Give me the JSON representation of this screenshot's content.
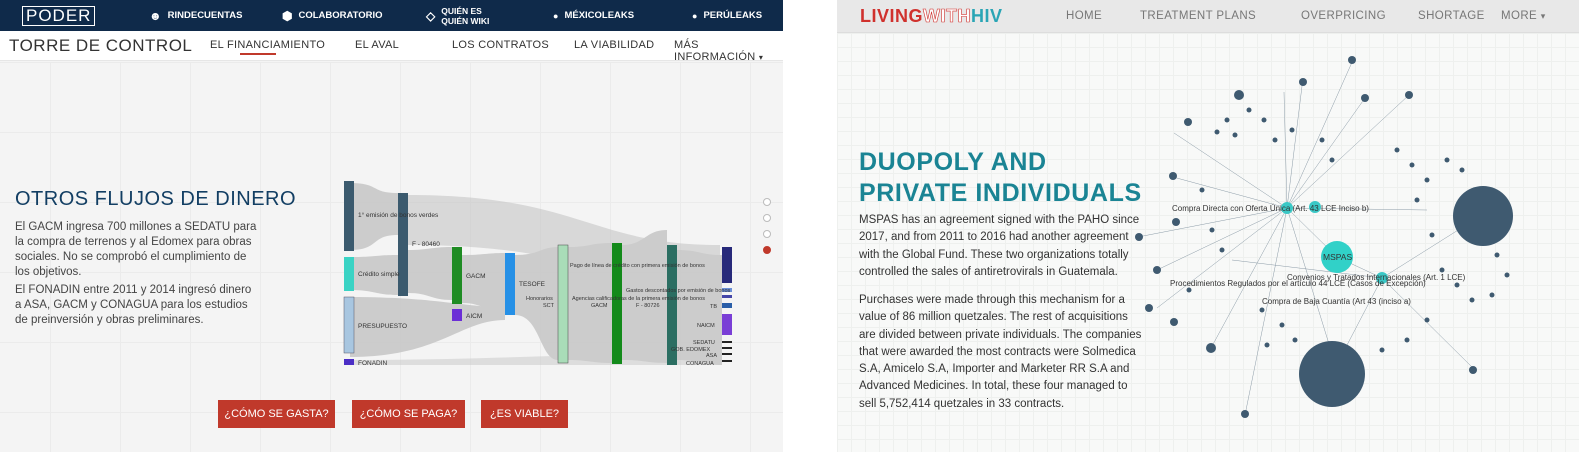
{
  "left": {
    "logo": "PODER",
    "top_nav": [
      {
        "icon": "☻",
        "icon_name": "rindecuentas-icon",
        "label": "RINDECUENTAS"
      },
      {
        "icon": "⬢",
        "icon_name": "cube-icon",
        "label": "COLABORATORIO"
      },
      {
        "icon": "◇",
        "icon_name": "wiki-icon",
        "label": "QUIÉN ES QUIÉN WIKI"
      },
      {
        "icon": "●",
        "icon_name": "drop-icon",
        "label": "MÉXICOLEAKS"
      },
      {
        "icon": "●",
        "icon_name": "drop-icon",
        "label": "PERÚLEAKS"
      }
    ],
    "site_title": "TORRE DE CONTROL",
    "sub_nav": [
      "EL FINANCIAMIENTO",
      "EL AVAL",
      "LOS CONTRATOS",
      "LA VIABILIDAD",
      "MÁS INFORMACIÓN"
    ],
    "heading": "OTROS FLUJOS DE DINERO",
    "para1": "El GACM ingresa 700 millones a SEDATU para la compra de terrenos y al Edomex para obras sociales. No se comprobó el cumplimiento de los objetivos.",
    "para2": "El FONADIN entre 2011 y 2014 ingresó dinero a ASA, GACM y CONAGUA para los estudios de preinversión y obras preliminares.",
    "buttons": [
      "¿CÓMO SE GASTA?",
      "¿CÓMO SE PAGA?",
      "¿ES VIABLE?"
    ],
    "accent": "#c0392b",
    "navy": "#0f2a4a",
    "sankey_labels": {
      "n1": "1° emisión de bonos verdes",
      "n2": "Crédito simple",
      "n3": "PRESUPUESTO",
      "n4": "FONADIN",
      "f": "F - 80460",
      "gacm": "GACM",
      "aicm": "AICM",
      "tesofe": "TESOFE",
      "pago": "Pago de línea de crédito con primera emisión de bonos",
      "gastos": "Gastos descontados por emisión de bonos",
      "hon": "Honorarios",
      "sct": "SCT",
      "agencias": "Agencias calificadoras de la primera emisión de bonos",
      "f2": "F - 80726",
      "gacm2": "GACM",
      "tb": "TB",
      "naicm": "NAICM",
      "sedatu": "SEDATU",
      "gob": "GOB. EDOMEX",
      "asa": "ASA",
      "conagua": "CONAGUA"
    }
  },
  "right": {
    "brand_a": "LIVING",
    "brand_b": "WITH",
    "brand_c": "HIV",
    "nav": [
      "HOME",
      "TREATMENT PLANS",
      "OVERPRICING",
      "SHORTAGE",
      "MORE"
    ],
    "title_line1": "DUOPOLY AND",
    "title_line2": "PRIVATE INDIVIDUALS",
    "para1": "MSPAS has an agreement signed with the PAHO since 2017, and from 2011 to 2016 had another agreement with the Global Fund. These two organizations totally controlled the sales of antiretrovirals in Guatemala.",
    "para2": "Purchases were made through this mechanism for a value of 86 million quetzales. The rest of acquisitions are divided between private individuals. The companies that were awarded the most contracts were Solmedica S.A, Amicelo S.A, Importer and Marketer RR S.A and Advanced Medicines. In total, these four managed to sell 5,752,414 quetzales in 33 contracts.",
    "network_labels": {
      "center": "MSPAS",
      "l1": "Compra Directa con Oferta Única (Art. 43 LCE Inciso b)",
      "l2": "Convenios y Tratados Internacionales (Art. 1 LCE)",
      "l3": "Procedimientos Regulados por el artículo 44 LCE (Casos de Excepción)",
      "l4": "Compra de Baja Cuantía (Art 43 (inciso a)"
    },
    "brand_red": "#d0312d",
    "brand_teal": "#2aa5b5",
    "title_color": "#1a8494"
  }
}
